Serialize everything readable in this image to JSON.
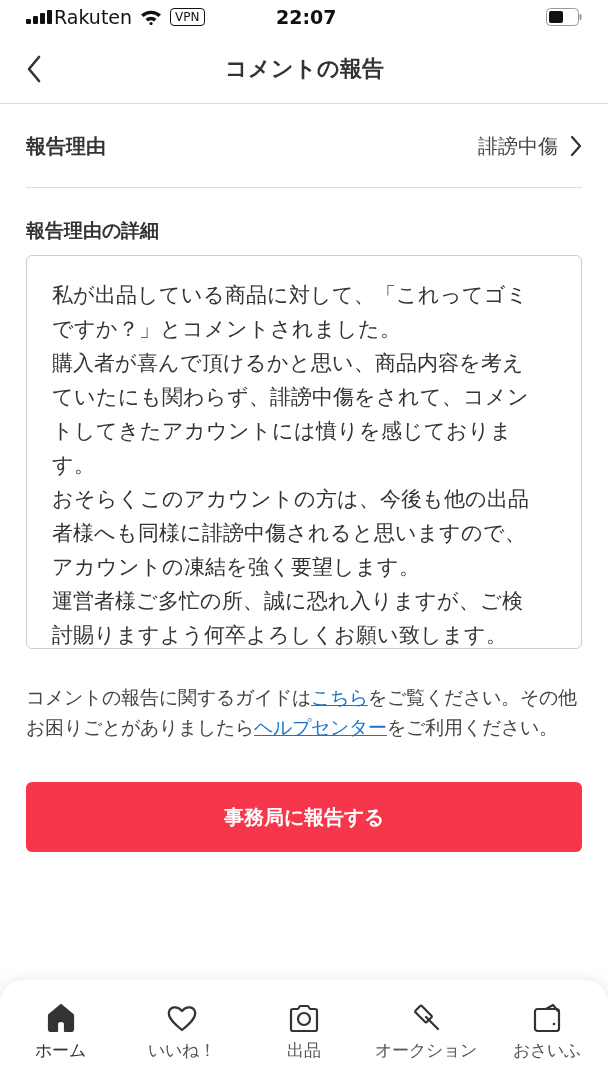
{
  "status_bar": {
    "carrier": "Rakuten",
    "vpn": "VPN",
    "time": "22:07"
  },
  "header": {
    "title": "コメントの報告"
  },
  "reason": {
    "label": "報告理由",
    "value": "誹謗中傷"
  },
  "details": {
    "label": "報告理由の詳細",
    "paragraphs": [
      "私が出品している商品に対して、「これってゴミですか？」とコメントされました。",
      "購入者が喜んで頂けるかと思い、商品内容を考えていたにも関わらず、誹謗中傷をされて、コメントしてきたアカウントには憤りを感じております。",
      "おそらくこのアカウントの方は、今後も他の出品者様へも同様に誹謗中傷されると思いますので、アカウントの凍結を強く要望します。",
      "運営者様ご多忙の所、誠に恐れ入りますが、ご検討賜りますよう何卒よろしくお願い致します。"
    ]
  },
  "guide": [
    {
      "kind": "text",
      "text": "コメントの報告に関するガイドは"
    },
    {
      "kind": "link",
      "text": "こちら"
    },
    {
      "kind": "text",
      "text": "をご覧ください。その他お困りごとがありましたら"
    },
    {
      "kind": "link",
      "text": "ヘルプセンター"
    },
    {
      "kind": "text",
      "text": "をご利用ください。"
    }
  ],
  "submit_button": "事務局に報告する",
  "tabs": [
    {
      "label": "ホーム",
      "selected": true
    },
    {
      "label": "いいね！",
      "selected": false
    },
    {
      "label": "出品",
      "selected": false
    },
    {
      "label": "オークション",
      "selected": false
    },
    {
      "label": "おさいふ",
      "selected": false
    }
  ]
}
